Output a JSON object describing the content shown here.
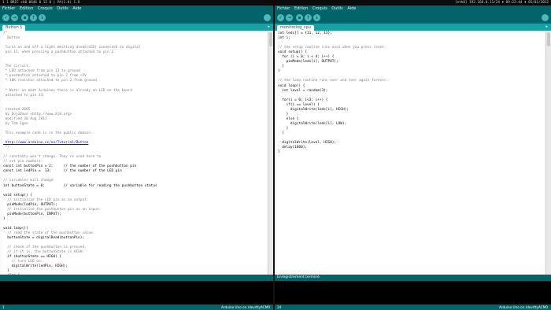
{
  "topbar": {
    "left": "1  1  BRIC  ch0  0646  0  12  0  |  PA(1.0) 1.8",
    "right": "[eth0] 192.168.0.11/24  ♦ 09:22:44  ♦ 05/01/2012"
  },
  "left_window": {
    "menu": [
      "Fichier",
      "Edition",
      "Croquis",
      "Outils",
      "Aide"
    ],
    "tab": "Button §",
    "code": [
      "/*",
      "  Button",
      "",
      " Turns on and off a light emitting diode(LED) connected to digital",
      " pin 13, when pressing a pushbutton attached to pin 2.",
      "",
      "",
      " The circuit:",
      " * LED attached from pin 13 to ground",
      " * pushbutton attached to pin 2 from +5V",
      " * 10K resistor attached to pin 2 from ground",
      "",
      " * Note: on most Arduinos there is already an LED on the board",
      " attached to pin 13.",
      "",
      "",
      " created 2005",
      " by DojoDave <http://www.0j0.org>",
      " modified 30 Aug 2011",
      " by Tom Igoe",
      "",
      " This example code is in the public domain.",
      "",
      " http://www.arduino.cc/en/Tutorial/Button",
      " */",
      "",
      "// constants won't change. They're used here to",
      "// set pin numbers:",
      "const int buttonPin = 2;     // the number of the pushbutton pin",
      "const int ledPin =  13;      // the number of the LED pin",
      "",
      "// variables will change:",
      "int buttonState = 0;         // variable for reading the pushbutton status",
      "",
      "void setup() {",
      "  // initialize the LED pin as an output:",
      "  pinMode(ledPin, OUTPUT);",
      "  // initialize the pushbutton pin as an input:",
      "  pinMode(buttonPin, INPUT);",
      "}",
      "",
      "void loop(){",
      "  // read the state of the pushbutton value:",
      "  buttonState = digitalRead(buttonPin);",
      "",
      "  // check if the pushbutton is pressed.",
      "  // if it is, the buttonState is HIGH:",
      "  if (buttonState == HIGH) {",
      "    // turn LED on:",
      "    digitalWrite(ledPin, HIGH);",
      "  }",
      "  else {",
      "    // turn LED off:",
      "    digitalWrite(ledPin, LOW);",
      "  }",
      "}"
    ],
    "message": "",
    "status_line": "1",
    "status_board": "Arduino Uno on /dev/ttyACM0"
  },
  "right_window": {
    "menu": [
      "Fichier",
      "Edition",
      "Croquis",
      "Outils",
      "Aide"
    ],
    "tab": "monitoring_cpu",
    "code": [
      "int leds[] = {11, 12, 13};",
      "int i;",
      "",
      "// the setup routine runs once when you press reset:",
      "void setup() {",
      "  for (i = 0; i < 4; i++) {",
      "    pinMode(leds[i], OUTPUT);",
      "  }",
      "}",
      "",
      "// the loop routine runs over and over again forever:",
      "void loop() {",
      "  int level = random(3);",
      "",
      "  for(i = 0; i<3; i++) {",
      "    if(i == level) {",
      "      digitalWrite(leds[i], HIGH);",
      "    }",
      "    else {",
      "      digitalWrite(leds[i], LOW);",
      "    }",
      "  }",
      "",
      "  digitalWrite(level, HIGH);",
      "  delay(1000);",
      "}"
    ],
    "message": "Enregistrement terminé.",
    "status_line": "24",
    "status_board": "Arduino Uno on /dev/ttyACM0"
  },
  "colors": {
    "teal_dark": "#006468",
    "teal_light": "#17a1a5",
    "button": "#4db7bb",
    "keyword": "#cc6600",
    "comment": "#7e7e7e",
    "url": "#0000ee"
  },
  "toolbar_icons": [
    "verify-icon",
    "upload-icon",
    "new-icon",
    "open-icon",
    "save-icon",
    "serial-monitor-icon"
  ]
}
